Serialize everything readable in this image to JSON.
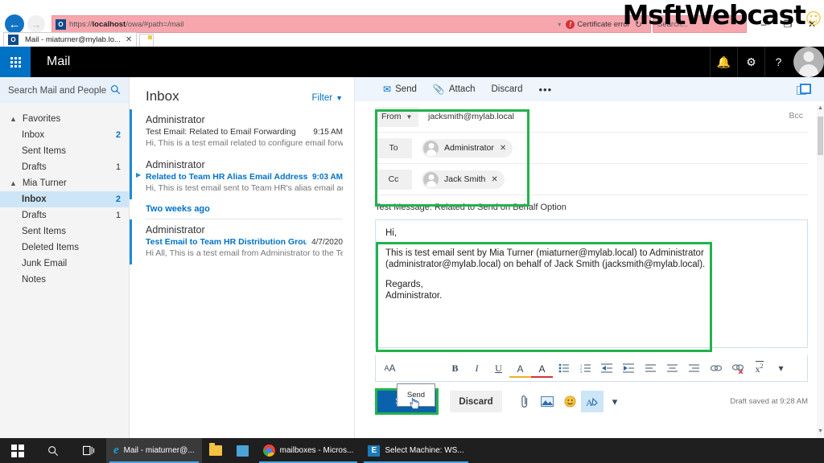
{
  "browser": {
    "url_prefix": "https://",
    "url_host": "localhost",
    "url_suffix": "/owa/#path=/mail",
    "cert_error": "Certificate error",
    "search_placeholder": "Search...",
    "tab_title": "Mail - miaturner@mylab.lo...",
    "minimize": "–",
    "restore": "❐",
    "close": "✕",
    "back_icon": "←",
    "forward_icon": "→",
    "refresh_icon": "↻",
    "caret_icon": "▾"
  },
  "watermark": {
    "text": "MsftWebcast",
    "dot": "☺"
  },
  "owa_header": {
    "title": "Mail",
    "icons": [
      {
        "name": "notifications-icon",
        "glyph": "🔔"
      },
      {
        "name": "settings-gear-icon",
        "glyph": "⚙"
      },
      {
        "name": "help-icon",
        "glyph": "?"
      }
    ]
  },
  "sidebar": {
    "search_placeholder": "Search Mail and People",
    "search_icon": "🔍",
    "groups": [
      {
        "label": "Favorites",
        "items": [
          {
            "label": "Inbox",
            "count": "2",
            "selected": false,
            "unread": true
          },
          {
            "label": "Sent Items",
            "count": "",
            "selected": false,
            "unread": false
          },
          {
            "label": "Drafts",
            "count": "1",
            "selected": false,
            "unread": false
          }
        ]
      },
      {
        "label": "Mia Turner",
        "items": [
          {
            "label": "Inbox",
            "count": "2",
            "selected": true,
            "unread": true
          },
          {
            "label": "Drafts",
            "count": "1",
            "selected": false,
            "unread": false
          },
          {
            "label": "Sent Items",
            "count": "",
            "selected": false,
            "unread": false
          },
          {
            "label": "Deleted Items",
            "count": "",
            "selected": false,
            "unread": false
          },
          {
            "label": "Junk Email",
            "count": "",
            "selected": false,
            "unread": false
          },
          {
            "label": "Notes",
            "count": "",
            "selected": false,
            "unread": false
          }
        ]
      }
    ]
  },
  "message_list": {
    "title": "Inbox",
    "filter_label": "Filter",
    "group_header": "Two weeks ago",
    "messages": [
      {
        "from": "Administrator",
        "subject": "Test Email: Related to Email Forwarding",
        "date": "9:15 AM",
        "preview": "Hi, This is a test email related to configure email forward...",
        "unread": false,
        "has_bar": true,
        "has_arrow": false
      },
      {
        "from": "Administrator",
        "subject": "Related to Team HR Alias Email Address",
        "date": "9:03 AM",
        "preview": "Hi, This is test email sent to Team HR's alias email addre...",
        "unread": true,
        "has_bar": true,
        "has_arrow": true
      },
      {
        "from": "Administrator",
        "subject": "Test Email to Team HR Distribution Group",
        "date": "4/7/2020",
        "preview": "Hi All, This is a test email from Administrator to the Tea...",
        "unread": true,
        "has_bar": true,
        "has_arrow": false
      }
    ]
  },
  "compose": {
    "toolbar": {
      "send_label": "Send",
      "send_icon": "✉",
      "attach_label": "Attach",
      "attach_icon": "📎",
      "discard_label": "Discard",
      "more_label": "•••",
      "popout_name": "pop-out-icon"
    },
    "from_label": "From",
    "from_value": "jacksmith@mylab.local",
    "to_label": "To",
    "to_chip": "Administrator",
    "cc_label": "Cc",
    "cc_chip": "Jack Smith",
    "bcc_label": "Bcc",
    "chip_remove": "✕",
    "subject": "Test Message: Related to Send on Behalf Option",
    "body_lines": [
      "Hi,",
      "This is test email sent by Mia Turner (miaturner@mylab.local) to Administrator (administrator@mylab.local) on behalf of Jack Smith (jacksmith@mylab.local).",
      "Regards,",
      "Administrator."
    ],
    "tooltip": "Send",
    "format_tools": [
      {
        "name": "font-size-icon",
        "glyph": "Aᴀ"
      },
      {
        "name": "bold-icon",
        "glyph": "B"
      },
      {
        "name": "italic-icon",
        "glyph": "I"
      },
      {
        "name": "underline-icon",
        "glyph": "U"
      },
      {
        "name": "highlight-icon",
        "glyph": "✐"
      },
      {
        "name": "font-color-icon",
        "glyph": "A"
      },
      {
        "name": "bulleted-list-icon",
        "glyph": "☰"
      },
      {
        "name": "numbered-list-icon",
        "glyph": "☷"
      },
      {
        "name": "decrease-indent-icon",
        "glyph": "⇤"
      },
      {
        "name": "increase-indent-icon",
        "glyph": "⇥"
      },
      {
        "name": "align-left-icon",
        "glyph": "≡"
      },
      {
        "name": "align-center-icon",
        "glyph": "≡"
      },
      {
        "name": "align-right-icon",
        "glyph": "≡"
      },
      {
        "name": "insert-link-icon",
        "glyph": "⚭"
      },
      {
        "name": "remove-link-icon",
        "glyph": "⚮"
      },
      {
        "name": "superscript-icon",
        "glyph": "x²"
      },
      {
        "name": "more-formatting-icon",
        "glyph": "⌄"
      }
    ],
    "actions": {
      "send_label": "Send",
      "discard_label": "Discard",
      "attach_icon": "📎",
      "image_icon": "🖼",
      "emoji_icon": "☺",
      "signature_icon": "✐",
      "more_icon": "⌄"
    },
    "draft_saved": "Draft saved at 9:28 AM"
  },
  "taskbar": {
    "start_name": "start-button",
    "search_icon": "🔍",
    "taskview_icon": "⌸",
    "apps": [
      {
        "label": "Mail - miaturner@...",
        "icon": "ie",
        "active": true
      },
      {
        "label": "",
        "icon": "folder",
        "active": false
      },
      {
        "label": "",
        "icon": "store",
        "active": false
      },
      {
        "label": "mailboxes - Micros...",
        "icon": "chrome",
        "active": false
      },
      {
        "label": "Select Machine: WS...",
        "icon": "exchange",
        "active": false
      }
    ]
  },
  "colors": {
    "accent_blue": "#0072c6",
    "highlight_green": "#22b24c",
    "send_blue": "#0a62ad",
    "urlbar_pink": "#f7a6ad"
  }
}
